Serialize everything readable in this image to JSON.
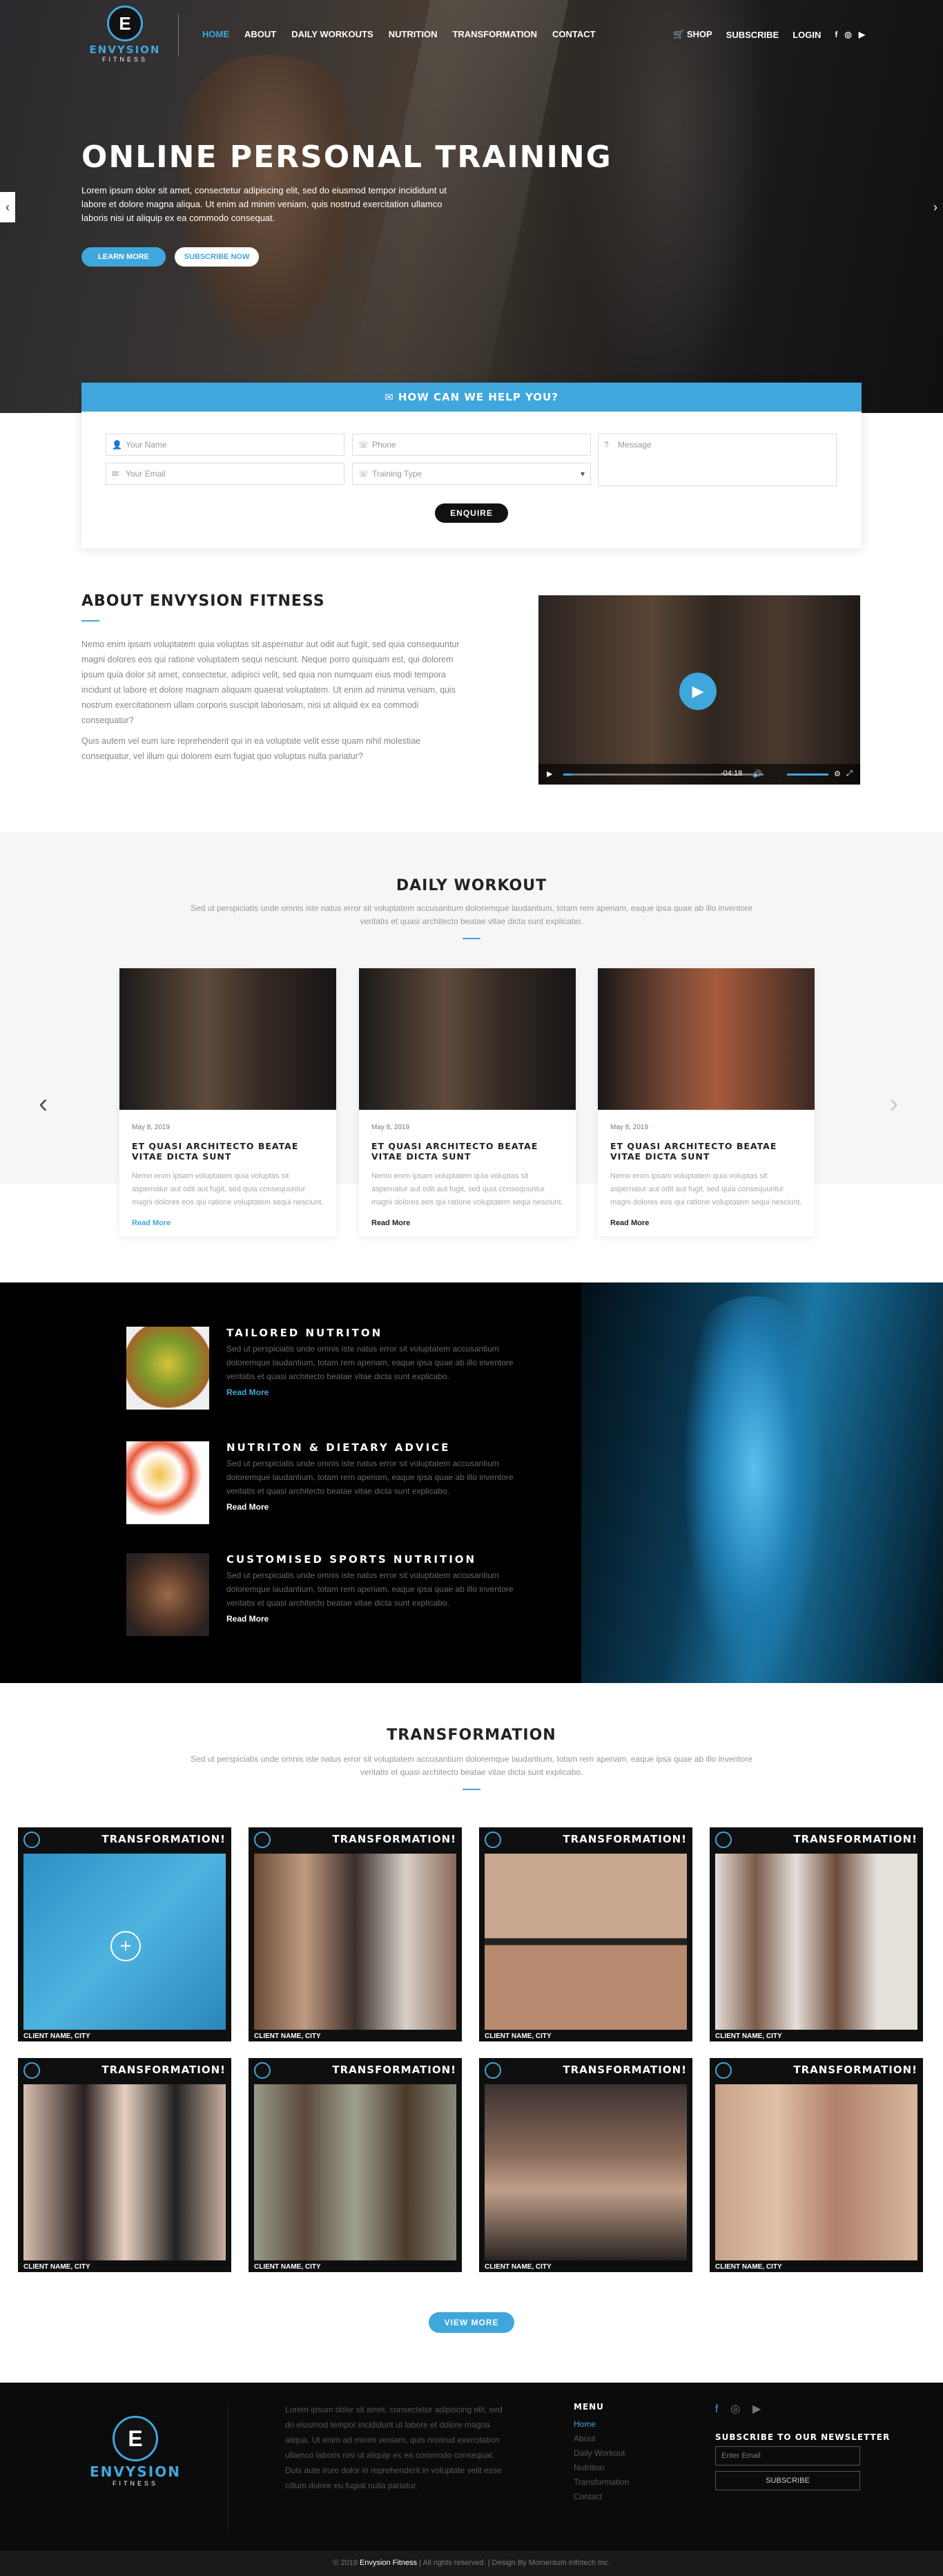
{
  "brand": {
    "name": "ENVYSION",
    "sub": "FITNESS",
    "emblem": "E"
  },
  "nav": [
    "HOME",
    "ABOUT",
    "DAILY WORKOUTS",
    "NUTRITION",
    "TRANSFORMATION",
    "CONTACT"
  ],
  "rightnav": {
    "shop": "SHOP",
    "subscribe": "SUBSCRIBE",
    "login": "LOGIN"
  },
  "hero": {
    "title": "ONLINE PERSONAL TRAINING",
    "text": "Lorem ipsum dolor sit amet, consectetur adipiscing elit, sed do eiusmod tempor incididunt ut labore et dolore magna aliqua. Ut enim ad minim veniam, quis nostrud exercitation ullamco laboris nisi ut aliquip ex ea commodo consequat.",
    "btn1": "LEARN MORE",
    "btn2": "SUBSCRIBE NOW"
  },
  "enquiry": {
    "title": "HOW CAN WE HELP YOU?",
    "name": "Your Name",
    "phone": "Phone",
    "message": "Message",
    "email": "Your Email",
    "training": "Training Type",
    "button": "ENQUIRE"
  },
  "about": {
    "title": "ABOUT ENVYSION FITNESS",
    "p1": "Nemo enim ipsam voluptatem quia voluptas sit aspernatur aut odit aut fugit, sed quia consequuntur magni dolores eos qui ratione voluptatem sequi nesciunt. Neque porro quisquam est, qui dolorem ipsum quia dolor sit amet, consectetur, adipisci velit, sed quia non numquam eius modi tempora incidunt ut labore et dolore magnam aliquam quaerat voluptatem. Ut enim ad minima veniam, quis nostrum exercitationem ullam corporis suscipit laboriosam, nisi ut aliquid ex ea commodi consequatur?",
    "p2": "Quis autem vel eum iure reprehenderit qui in ea voluptate velit esse quam nihil molestiae consequatur, vel illum qui dolorem eum fugiat quo voluptas nulla pariatur?",
    "time": "-04:18"
  },
  "daily": {
    "title": "DAILY WORKOUT",
    "sub": "Sed ut perspiciatis unde omnis iste natus error sit voluptatem accusantium doloremque laudantium, totam rem aperiam, eaque ipsa quae ab illo inventore veritatis et quasi architecto beatae vitae dicta sunt explicabo.",
    "cards": [
      {
        "date": "May 8, 2019",
        "title": "ET QUASI ARCHITECTO BEATAE VITAE DICTA SUNT",
        "text": "Nemo enim ipsam voluptatem quia voluptas sit aspernatur aut odit aut fugit, sed quia consequuntur magni dolores eos qui ratione voluptatem sequi nesciunt.",
        "more": "Read More"
      },
      {
        "date": "May 8, 2019",
        "title": "ET QUASI ARCHITECTO BEATAE VITAE DICTA SUNT",
        "text": "Nemo enim ipsam voluptatem quia voluptas sit aspernatur aut odit aut fugit, sed quia consequuntur magni dolores eos qui ratione voluptatem sequi nesciunt.",
        "more": "Read More"
      },
      {
        "date": "May 8, 2019",
        "title": "ET QUASI ARCHITECTO BEATAE VITAE DICTA SUNT",
        "text": "Nemo enim ipsam voluptatem quia voluptas sit aspernatur aut odit aut fugit, sed quia consequuntur magni dolores eos qui ratione voluptatem sequi nesciunt.",
        "more": "Read More"
      }
    ]
  },
  "nutrition": [
    {
      "title": "TAILORED NUTRITON",
      "text": "Sed ut perspiciatis unde omnis iste natus error sit voluptatem accusantium doloremque laudantium, totam rem aperiam, eaque ipsa quae ab illo inventore veritatis et quasi architecto beatae vitae dicta sunt explicabo.",
      "more": "Read More"
    },
    {
      "title": "NUTRITON & DIETARY ADVICE",
      "text": "Sed ut perspiciatis unde omnis iste natus error sit voluptatem accusantium doloremque laudantium, totam rem aperiam, eaque ipsa quae ab illo inventore veritatis et quasi architecto beatae vitae dicta sunt explicabo.",
      "more": "Read More"
    },
    {
      "title": "CUSTOMISED SPORTS NUTRITION",
      "text": "Sed ut perspiciatis unde omnis iste natus error sit voluptatem accusantium doloremque laudantium, totam rem aperiam, eaque ipsa quae ab illo inventore veritatis et quasi architecto beatae vitae dicta sunt explicabo.",
      "more": "Read More"
    }
  ],
  "transformation": {
    "title": "TRANSFORMATION",
    "sub": "Sed ut perspiciatis unde omnis iste natus error sit voluptatem accusantium doloremque laudantium, totam rem aperiam, eaque ipsa quae ab illo inventore veritatis et quasi architecto beatae vitae dicta sunt explicabo.",
    "label": "TRANSFORMATION!",
    "city": "CLIENT NAME, CITY",
    "button": "VIEW MORE"
  },
  "footer": {
    "text": "Lorem ipsum dolor sit amet, consectetur adipiscing elit, sed do eiusmod tempor incididunt ut labore et dolore magna aliqua. Ut enim ad minim veniam, quis nostrud exercitation ullamco laboris nisi ut aliquip ex ea commodo consequat. Duis aute irure dolor in reprehenderit in voluptate velit esse cillum dolore eu fugiat nulla pariatur.",
    "menu_title": "MENU",
    "menu": [
      "Home",
      "About",
      "Daily Workout",
      "Nutrition",
      "Transformation",
      "Contact"
    ],
    "nl_title": "SUBSCRIBE TO OUR NEWSLETTER",
    "nl_placeholder": "Enter Email",
    "nl_button": "SUBSCRIBE"
  },
  "copyright": {
    "pre": "© 2019",
    "brand": "Envysion Fitness",
    "post": "| All rights reserved. | Design By Momentum Infotech Inc."
  }
}
